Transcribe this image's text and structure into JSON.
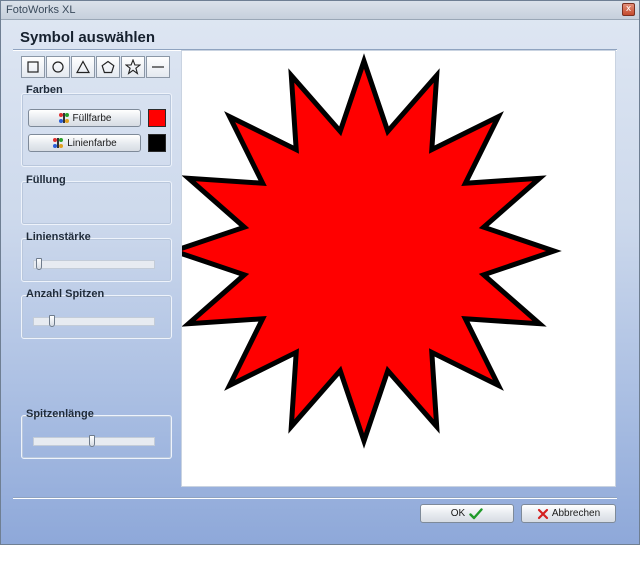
{
  "window": {
    "title": "FotoWorks XL",
    "close_glyph": "x"
  },
  "dialog": {
    "heading": "Symbol auswählen"
  },
  "shape_tools": [
    {
      "name": "square-icon"
    },
    {
      "name": "circle-icon"
    },
    {
      "name": "triangle-icon"
    },
    {
      "name": "pentagon-icon"
    },
    {
      "name": "star-icon"
    },
    {
      "name": "line-icon"
    }
  ],
  "farben": {
    "label": "Farben",
    "fill_button": "Füllfarbe",
    "line_button": "Linienfarbe",
    "fill_color": "#ff0000",
    "line_color": "#000000"
  },
  "fuellung": {
    "label": "Füllung"
  },
  "linienstaerke": {
    "label": "Linienstärke",
    "value_fraction": 0.02
  },
  "anzahl_spitzen": {
    "label": "Anzahl Spitzen",
    "value_fraction": 0.13
  },
  "spitzenlaenge": {
    "label": "Spitzenlänge",
    "value_fraction": 0.48
  },
  "preview": {
    "shape": "star",
    "points": 16,
    "fill": "#ff0000",
    "stroke": "#000000"
  },
  "footer": {
    "ok_label": "OK",
    "cancel_label": "Abbrechen"
  }
}
